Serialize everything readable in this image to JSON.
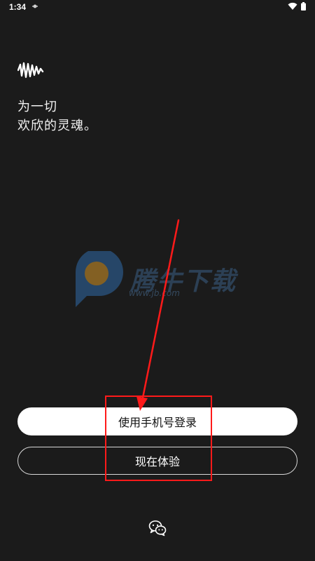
{
  "status_bar": {
    "time": "1:34"
  },
  "slogan": {
    "line1": "为一切",
    "line2": "欢欣的灵魂。"
  },
  "watermark": {
    "text": "腾牛下载",
    "url": "www.jb.com"
  },
  "buttons": {
    "phone_login_label": "使用手机号登录",
    "try_now_label": "现在体验"
  },
  "colors": {
    "background": "#1b1b1b",
    "primary_button": "#ffffff",
    "annotation": "#ff1a1a"
  },
  "icons": {
    "logo": "soundwave-logo-icon",
    "login_alt": "wechat-icon"
  }
}
